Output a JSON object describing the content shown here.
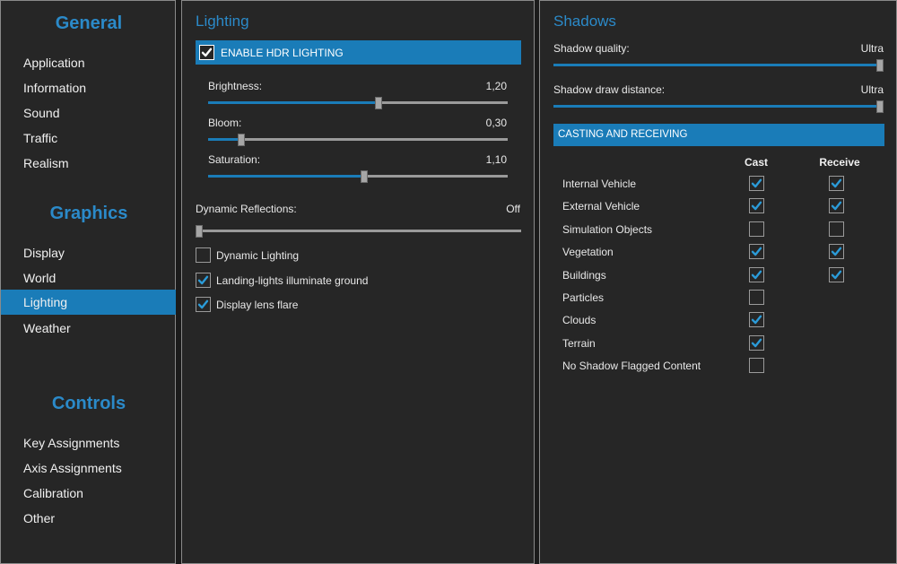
{
  "sidebar": {
    "sections": [
      {
        "title": "General",
        "items": [
          "Application",
          "Information",
          "Sound",
          "Traffic",
          "Realism"
        ]
      },
      {
        "title": "Graphics",
        "items": [
          "Display",
          "World",
          "Lighting",
          "Weather"
        ]
      },
      {
        "title": "Controls",
        "items": [
          "Key Assignments",
          "Axis Assignments",
          "Calibration",
          "Other"
        ]
      }
    ],
    "active_item": "Lighting"
  },
  "lighting": {
    "title": "Lighting",
    "hdr_label": "ENABLE HDR LIGHTING",
    "hdr_checked": true,
    "brightness": {
      "label": "Brightness:",
      "value": "1,20",
      "fraction": 0.57
    },
    "bloom": {
      "label": "Bloom:",
      "value": "0,30",
      "fraction": 0.11
    },
    "saturation": {
      "label": "Saturation:",
      "value": "1,10",
      "fraction": 0.52
    },
    "reflections": {
      "label": "Dynamic Reflections:",
      "value": "Off",
      "fraction": 0.0
    },
    "options": [
      {
        "label": "Dynamic Lighting",
        "checked": false
      },
      {
        "label": "Landing-lights illuminate ground",
        "checked": true
      },
      {
        "label": "Display lens flare",
        "checked": true
      }
    ]
  },
  "shadows": {
    "title": "Shadows",
    "quality": {
      "label": "Shadow quality:",
      "value": "Ultra",
      "fraction": 1.0
    },
    "distance": {
      "label": "Shadow draw distance:",
      "value": "Ultra",
      "fraction": 1.0
    },
    "casting_header": "CASTING AND RECEIVING",
    "cast_header": "Cast",
    "receive_header": "Receive",
    "rows": [
      {
        "label": "Internal Vehicle",
        "cast": true,
        "receive": true,
        "has_receive": true
      },
      {
        "label": "External Vehicle",
        "cast": true,
        "receive": true,
        "has_receive": true
      },
      {
        "label": "Simulation Objects",
        "cast": false,
        "receive": false,
        "has_receive": true
      },
      {
        "label": "Vegetation",
        "cast": true,
        "receive": true,
        "has_receive": true
      },
      {
        "label": "Buildings",
        "cast": true,
        "receive": true,
        "has_receive": true
      },
      {
        "label": "Particles",
        "cast": false,
        "receive": false,
        "has_receive": false
      },
      {
        "label": "Clouds",
        "cast": true,
        "receive": false,
        "has_receive": false
      },
      {
        "label": "Terrain",
        "cast": true,
        "receive": false,
        "has_receive": false
      },
      {
        "label": "No Shadow Flagged Content",
        "cast": false,
        "receive": false,
        "has_receive": false
      }
    ]
  }
}
